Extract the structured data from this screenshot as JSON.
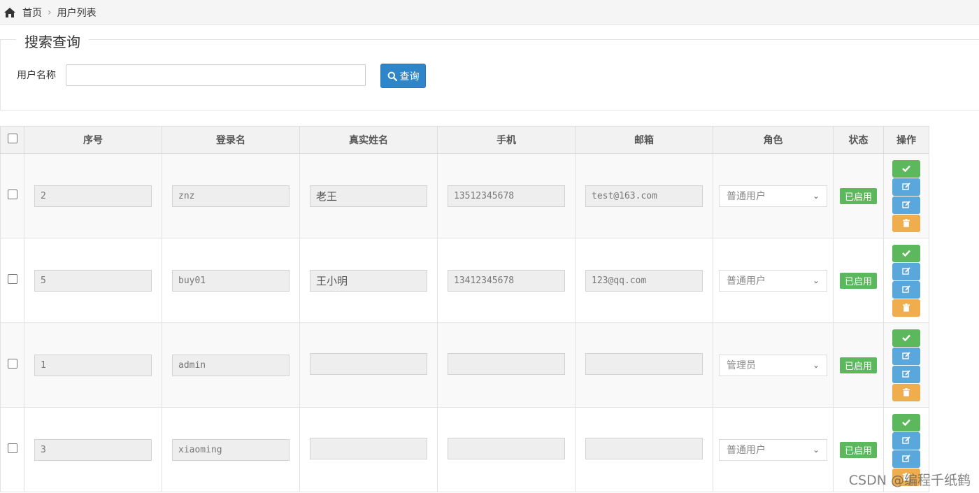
{
  "breadcrumb": {
    "home": "首页",
    "current": "用户列表"
  },
  "search": {
    "legend": "搜索查询",
    "label": "用户名称",
    "value": "",
    "button": "查询"
  },
  "table": {
    "columns": [
      "序号",
      "登录名",
      "真实姓名",
      "手机",
      "邮箱",
      "角色",
      "状态",
      "操作"
    ],
    "rows": [
      {
        "id": "2",
        "login": "znz",
        "name": "老王",
        "phone": "13512345678",
        "email": "test@163.com",
        "role": "普通用户",
        "status": "已启用"
      },
      {
        "id": "5",
        "login": "buy01",
        "name": "王小明",
        "phone": "13412345678",
        "email": "123@qq.com",
        "role": "普通用户",
        "status": "已启用"
      },
      {
        "id": "1",
        "login": "admin",
        "name": "",
        "phone": "",
        "email": "",
        "role": "管理员",
        "status": "已启用"
      },
      {
        "id": "3",
        "login": "xiaoming",
        "name": "",
        "phone": "",
        "email": "",
        "role": "普通用户",
        "status": "已启用"
      }
    ]
  },
  "watermark": "CSDN @编程千纸鹤",
  "colors": {
    "primary": "#2e86c8",
    "success": "#5cb85c",
    "info": "#5aa7dc",
    "warning": "#f0ad4e"
  },
  "icons": {
    "home": "home-icon",
    "search": "search-icon",
    "check": "check-icon",
    "edit": "edit-icon",
    "delete": "trash-icon"
  }
}
